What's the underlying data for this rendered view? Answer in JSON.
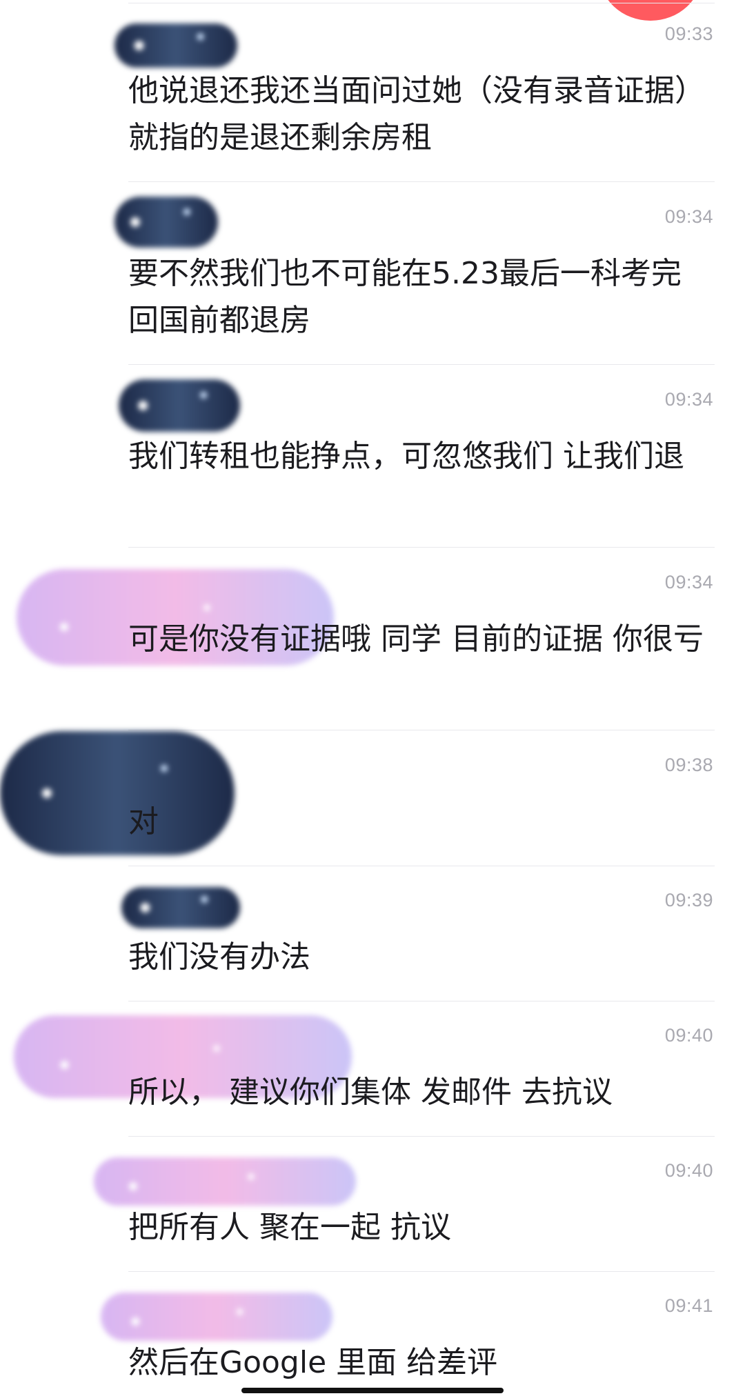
{
  "messages": [
    {
      "time": "09:33",
      "text": "他说退还我还当面问过她（没有录音证据）就指的是退还剩余房租"
    },
    {
      "time": "09:34",
      "text": "要不然我们也不可能在5.23最后一科考完 回国前都退房"
    },
    {
      "time": "09:34",
      "text": "我们转租也能挣点，可忽悠我们 让我们退"
    },
    {
      "time": "09:34",
      "text": "可是你没有证据哦 同学 目前的证据 你很亏"
    },
    {
      "time": "09:38",
      "text": "对"
    },
    {
      "time": "09:39",
      "text": "我们没有办法"
    },
    {
      "time": "09:40",
      "text": "所以， 建议你们集体 发邮件 去抗议"
    },
    {
      "time": "09:40",
      "text": "把所有人 聚在一起 抗议"
    },
    {
      "time": "09:41",
      "text": "然后在Google 里面 给差评"
    }
  ],
  "colors": {
    "background": "#ffffff",
    "text": "#1b1b1f",
    "time": "#a9a9b0",
    "divider": "#e8e8ec",
    "badge": "#ff5a5f"
  }
}
